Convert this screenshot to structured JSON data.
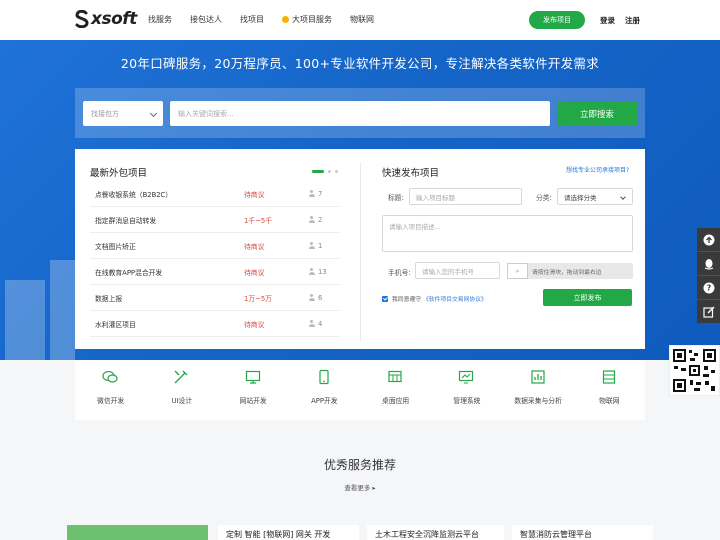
{
  "header": {
    "logo_text": "xsoft",
    "nav": [
      "找服务",
      "接包达人",
      "找项目",
      "大项目服务",
      "物联网"
    ],
    "publish_button": "发布项目",
    "login": "登录",
    "register": "注册"
  },
  "hero": {
    "title": "20年口碑服务，20万程序员、100+专业软件开发公司，专注解决各类软件开发需求",
    "search_category": "找接包方",
    "search_placeholder": "输入关键词搜索...",
    "search_button": "立即搜索"
  },
  "projects": {
    "title": "最新外包项目",
    "items": [
      {
        "name": "点餐收银系统（B2B2C）",
        "price": "待商议",
        "count": "7"
      },
      {
        "name": "指定群消息自动转发",
        "price": "1千~5千",
        "count": "2"
      },
      {
        "name": "文档图片矫正",
        "price": "待商议",
        "count": "1"
      },
      {
        "name": "在线教育APP混合开发",
        "price": "待商议",
        "count": "13"
      },
      {
        "name": "数据上报",
        "price": "1万~5万",
        "count": "6"
      },
      {
        "name": "水利灌区项目",
        "price": "待商议",
        "count": "4"
      }
    ]
  },
  "quick_publish": {
    "title": "快速发布项目",
    "find_link": "想找专业公司承接项目?",
    "title_label": "标题:",
    "title_placeholder": "输入项目标题",
    "category_label": "分类:",
    "category_value": "请选择分类",
    "desc_placeholder": "请输入项目描述...",
    "phone_label": "手机号:",
    "phone_placeholder": "请输入您的手机号",
    "slider_handle": "»",
    "slider_text": "请按住滑块，拖动到最右边",
    "agree_text": "我同意遵守",
    "agree_link": "《软件项目交易网协议》",
    "submit": "立即发布"
  },
  "services": [
    {
      "label": "微信开发",
      "icon": "wechat-icon"
    },
    {
      "label": "UI设计",
      "icon": "design-icon"
    },
    {
      "label": "网站开发",
      "icon": "website-icon"
    },
    {
      "label": "APP开发",
      "icon": "mobile-icon"
    },
    {
      "label": "桌面应用",
      "icon": "desktop-app-icon"
    },
    {
      "label": "管理系统",
      "icon": "management-icon"
    },
    {
      "label": "数据采集与分析",
      "icon": "data-icon"
    },
    {
      "label": "物联网",
      "icon": "iot-icon"
    }
  ],
  "recommend": {
    "title": "优秀服务推荐",
    "more": "查看更多 ▸",
    "cards": [
      "定制  智能 [物联网] 网关  开发",
      "土木工程安全沉降监测云平台",
      "智慧消防云管理平台"
    ]
  },
  "colors": {
    "primary_green": "#22a847",
    "hero_blue": "#1565c8",
    "accent_red": "#e0453b",
    "link_blue": "#2d7ad6"
  }
}
